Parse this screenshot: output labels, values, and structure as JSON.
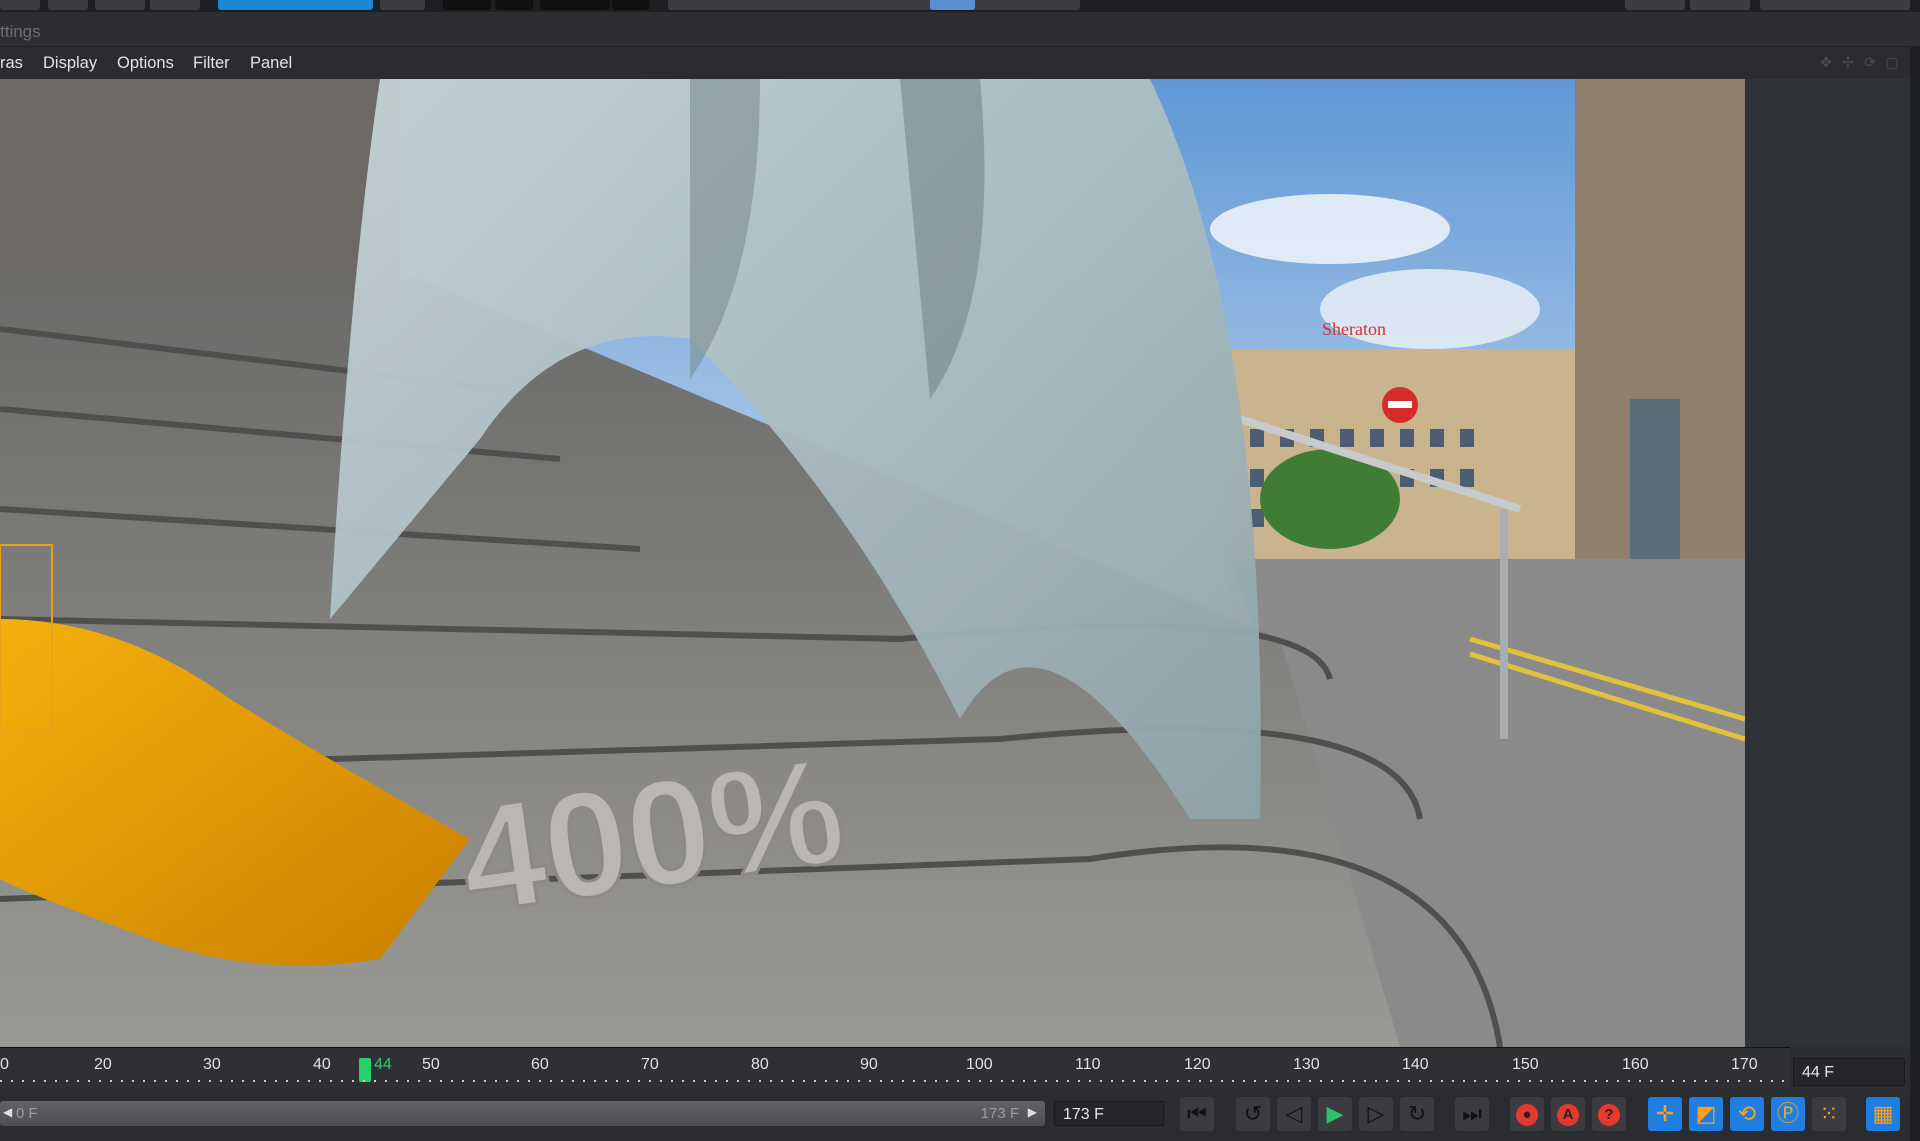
{
  "settings_label": "ttings",
  "menu": {
    "items": [
      "ras",
      "Display",
      "Options",
      "Filter",
      "Panel"
    ]
  },
  "viewport": {
    "render_text": "400%",
    "sign_text": "Sheraton"
  },
  "timeline": {
    "ticks": [
      "0",
      "20",
      "30",
      "40",
      "50",
      "60",
      "70",
      "80",
      "90",
      "100",
      "110",
      "120",
      "130",
      "140",
      "150",
      "160",
      "170"
    ],
    "current_frame_label": "44",
    "current_frame_field": "44 F",
    "current_frame": 44
  },
  "range": {
    "start": "0 F",
    "end": "173 F",
    "end_field": "173 F"
  },
  "icons": {
    "transport": [
      "go-to-start-icon",
      "previous-key-icon",
      "step-back-icon",
      "play-icon",
      "step-forward-icon",
      "next-key-icon",
      "go-to-end-icon"
    ],
    "record": [
      "record-icon",
      "autokey-icon",
      "keyframe-selection-icon"
    ],
    "keys": [
      "position-key-icon",
      "scale-key-icon",
      "rotation-key-icon",
      "parameter-key-icon",
      "point-level-icon",
      "film-icon"
    ]
  },
  "colors": {
    "accent_blue": "#1e86d6",
    "playhead_green": "#25d36b",
    "record_red": "#e5382f",
    "key_orange": "#ff9f1a"
  }
}
